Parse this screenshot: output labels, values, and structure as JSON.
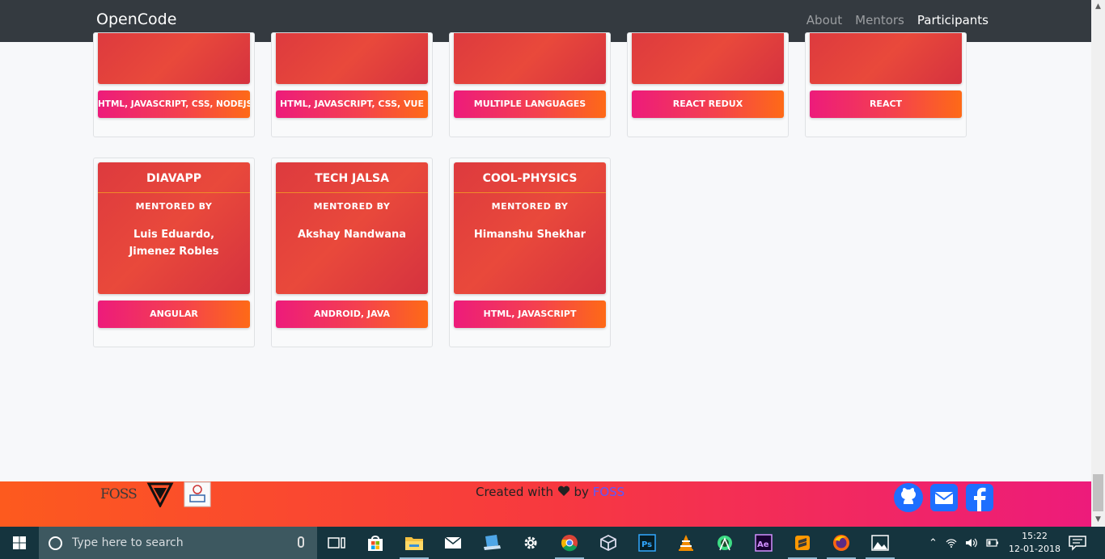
{
  "navbar": {
    "brand": "OpenCode",
    "links": [
      {
        "label": "About"
      },
      {
        "label": "Mentors"
      },
      {
        "label": "Participants"
      }
    ]
  },
  "top_cards": [
    {
      "tag": "HTML, JAVASCRIPT, CSS, NODEJS"
    },
    {
      "tag": "HTML, JAVASCRIPT, CSS, VUE"
    },
    {
      "tag": "MULTIPLE LANGUAGES"
    },
    {
      "tag": "REACT REDUX"
    },
    {
      "tag": "REACT"
    }
  ],
  "projects": [
    {
      "title": "DIAVAPP",
      "mentored_label": "MENTORED BY",
      "mentor": "Luis Eduardo, Jimenez Robles",
      "tag": "ANGULAR"
    },
    {
      "title": "TECH JALSA",
      "mentored_label": "MENTORED BY",
      "mentor": "Akshay Nandwana",
      "tag": "ANDROID, JAVA"
    },
    {
      "title": "COOL-PHYSICS",
      "mentored_label": "MENTORED BY",
      "mentor": "Himanshu Shekhar",
      "tag": "HTML, JAVASCRIPT"
    }
  ],
  "footer": {
    "foss_logo": "FOSS",
    "credit_prefix": "Created with",
    "credit_by": "by",
    "credit_link": "FOSS",
    "icons": [
      "github-icon",
      "mail-icon",
      "facebook-icon"
    ]
  },
  "taskbar": {
    "search_placeholder": "Type here to search",
    "time": "15:22",
    "date": "12-01-2018",
    "apps": [
      "task-view-icon",
      "store-icon",
      "file-explorer-icon",
      "mail-app-icon",
      "laptop-app-icon",
      "settings-icon",
      "chrome-icon",
      "virtualbox-icon",
      "photoshop-icon",
      "vlc-icon",
      "android-studio-icon",
      "after-effects-icon",
      "sublime-text-icon",
      "firefox-icon",
      "photos-icon"
    ]
  },
  "colors": {
    "navbar": "#343a40",
    "card": "#e0403d",
    "tag_start": "#ed1b7b",
    "tag_end": "#fe6a17",
    "footer_start": "#fd5a1e",
    "footer_end": "#ed1b7b",
    "icon_blue": "#1e6fff"
  }
}
